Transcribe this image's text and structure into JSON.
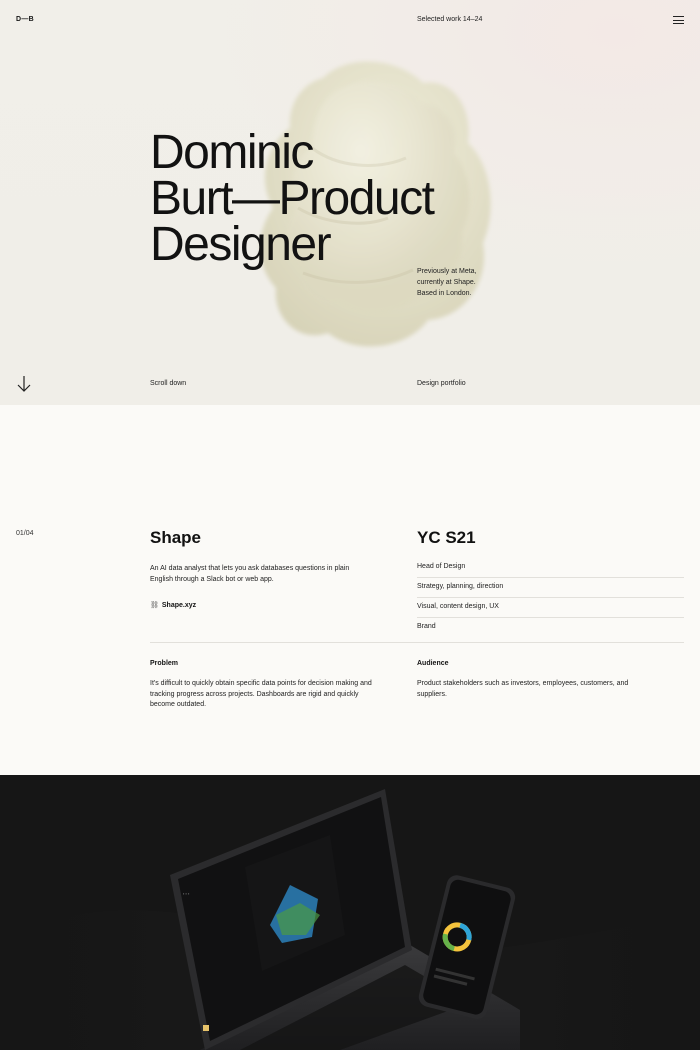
{
  "header": {
    "logo": "D—B",
    "center": "Selected work 14–24",
    "menu_icon": "hamburger-menu-icon"
  },
  "hero": {
    "headline": "Dominic\nBurt—Product\nDesigner",
    "intro": "Previously at Meta,\ncurrently at Shape.\nBased in London.",
    "scroll_label": "Scroll down",
    "portfolio_label": "Design portfolio",
    "arrow_icon": "arrow-down-icon"
  },
  "project": {
    "counter": "01/04",
    "name": "Shape",
    "description": "An AI data analyst that lets you ask databases questions in plain English through a Slack bot or web app.",
    "link_icon": "link-icon",
    "link": "Shape.xyz",
    "batch": "YC S21",
    "roles": [
      "Head of Design",
      "Strategy, planning, direction",
      "Visual, content design, UX",
      "Brand"
    ],
    "problem_title": "Problem",
    "problem_text": "It's difficult to quickly obtain specific data points for decision making and tracking progress across projects. Dashboards are rigid and quickly become outdated.",
    "audience_title": "Audience",
    "audience_text": "Product stakeholders such as investors, employees, customers, and suppliers."
  },
  "showcase": {
    "device_label": "laptop-and-phone-mockup"
  },
  "colors": {
    "hero_bg": "#f0eee8",
    "page_bg": "#fbfaf7",
    "dark_bg": "#161616",
    "text": "#141414"
  }
}
